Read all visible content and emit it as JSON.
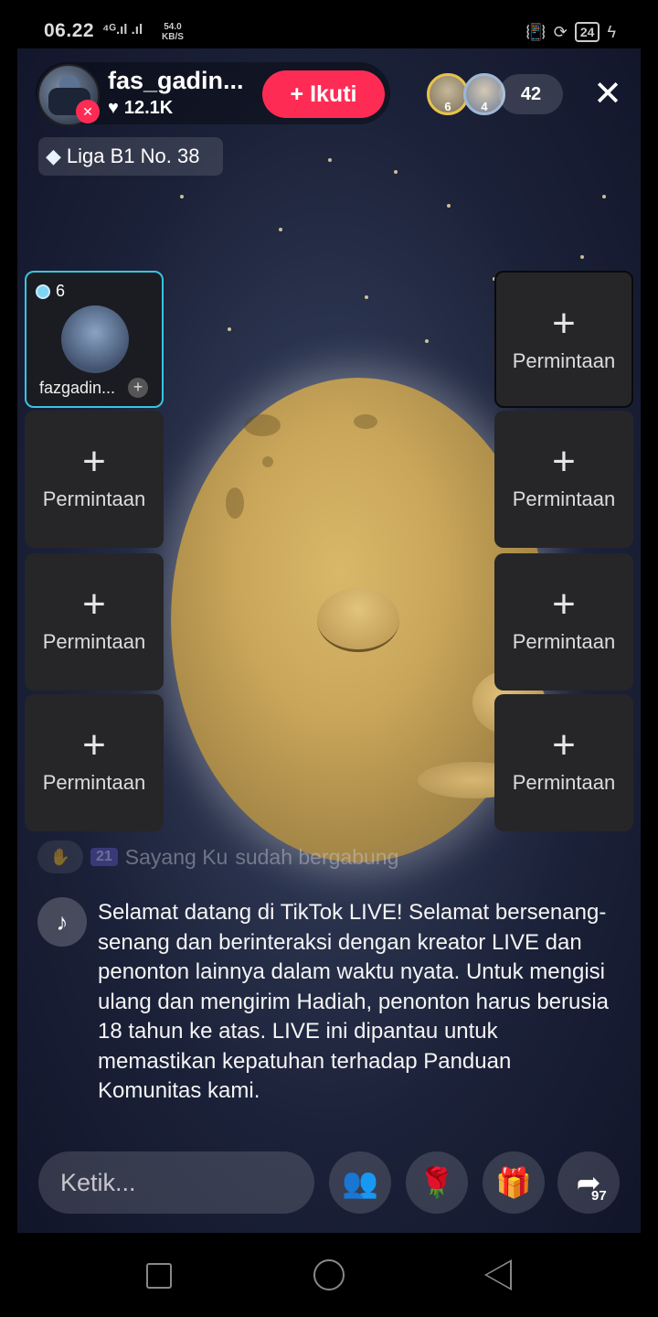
{
  "status_bar": {
    "time": "06.22",
    "signal": "⁴ᴳ.ıl .ıl",
    "speed_value": "54.0",
    "speed_unit": "KB/S",
    "battery": "24"
  },
  "host": {
    "name": "fas_gadin...",
    "likes": "12.1K",
    "follow_label": "+ Ikuti",
    "league_label": "Liga B1 No. 38"
  },
  "viewers": {
    "top": [
      {
        "rank": "6"
      },
      {
        "rank": "4"
      }
    ],
    "count": "42"
  },
  "guest": {
    "badge_count": "6",
    "name": "fazgadin..."
  },
  "slots": {
    "plus": "+",
    "label": "Permintaan"
  },
  "chat": {
    "join_badge": "21",
    "join_user": "Sayang Ku",
    "join_text": "sudah bergabung",
    "welcome_message": "Selamat datang di TikTok LIVE! Selamat bersenang-senang dan berinteraksi dengan kreator LIVE dan penonton lainnya dalam waktu nyata. Untuk mengisi ulang dan mengirim Hadiah, penonton harus berusia 18 tahun ke atas. LIVE ini dipantau untuk memastikan kepatuhan terhadap Panduan Komunitas kami."
  },
  "bottom_bar": {
    "input_placeholder": "Ketik...",
    "share_count": "97"
  },
  "colors": {
    "accent": "#fe2c55",
    "guest_border": "#38c4e0"
  },
  "icons": {
    "close": "close-icon",
    "heart": "heart-icon",
    "mic_off": "mic-off-icon",
    "gem": "gem-icon",
    "tiktok": "tiktok-icon",
    "guests": "multi-guest-icon",
    "rose": "rose-icon",
    "gift": "gift-icon",
    "share": "share-icon"
  }
}
